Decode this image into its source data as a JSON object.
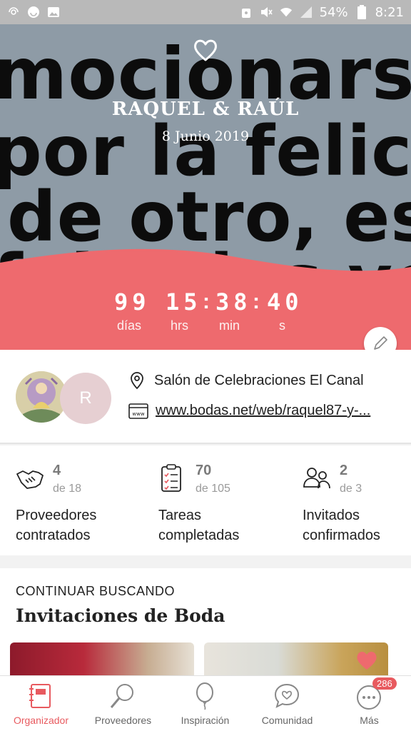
{
  "status_bar": {
    "battery": "54%",
    "time": "8:21"
  },
  "hero": {
    "background_text": [
      "mocionars",
      "por la felicidad",
      "de otro, es se",
      "feliz dos veces"
    ],
    "names": "RAQUEL & RAÚL",
    "date": "8 Junio 2019",
    "countdown": {
      "days": "99",
      "days_label": "días",
      "hours": "15",
      "hours_label": "hrs",
      "minutes": "38",
      "minutes_label": "min",
      "seconds": "40",
      "seconds_label": "s"
    },
    "accent_color": "#ee6a6e"
  },
  "info": {
    "avatar_initial": "R",
    "venue": "Salón de Celebraciones El Canal",
    "website": "www.bodas.net/web/raquel87-y-..."
  },
  "stats": [
    {
      "icon": "handshake-icon",
      "value": "4",
      "of": "de 18",
      "label_line1": "Proveedores",
      "label_line2": "contratados"
    },
    {
      "icon": "checklist-icon",
      "value": "70",
      "of": "de 105",
      "label_line1": "Tareas",
      "label_line2": "completadas"
    },
    {
      "icon": "guests-icon",
      "value": "2",
      "of": "de 3",
      "label_line1": "Invitados",
      "label_line2": "confirmados"
    }
  ],
  "continue_searching": {
    "kicker": "CONTINUAR BUSCANDO",
    "title": "Invitaciones de Boda"
  },
  "bottom_nav": {
    "items": [
      {
        "label": "Organizador",
        "icon": "planner-icon",
        "active": true
      },
      {
        "label": "Proveedores",
        "icon": "magnifier-icon"
      },
      {
        "label": "Inspiración",
        "icon": "balloon-icon"
      },
      {
        "label": "Comunidad",
        "icon": "chat-heart-icon"
      },
      {
        "label": "Más",
        "icon": "more-icon",
        "badge": "286"
      }
    ]
  }
}
